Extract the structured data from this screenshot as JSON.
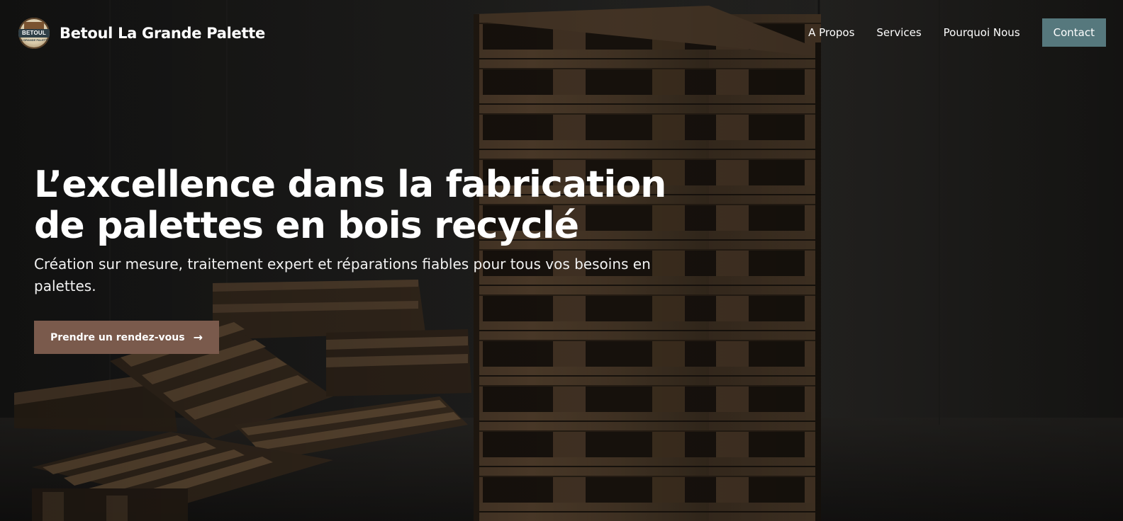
{
  "brand": {
    "logo_word": "BETOUL",
    "logo_sub": "LA GRANDE PALETTE",
    "name": "Betoul La Grande Palette"
  },
  "nav": {
    "items": [
      {
        "label": "A Propos"
      },
      {
        "label": "Services"
      },
      {
        "label": "Pourquoi Nous"
      }
    ],
    "cta_label": "Contact"
  },
  "hero": {
    "title": "L’excellence dans la fabrication de palettes en bois recyclé",
    "subtitle": "Création sur mesure, traitement expert et réparations fiables pour tous vos besoins en palettes.",
    "button_label": "Prendre un rendez-vous",
    "button_icon": "arrow-right-icon"
  },
  "colors": {
    "cta_background": "#56787d",
    "hero_button_background": "#7a5a4c",
    "text": "#ffffff"
  }
}
